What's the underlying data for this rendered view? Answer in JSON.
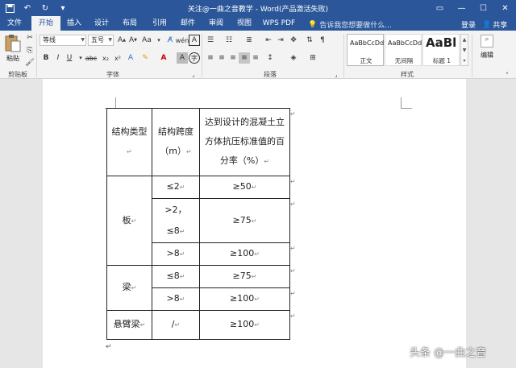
{
  "window": {
    "title": "关注@一曲之音教学 - Word(产品激活失败)",
    "qat_save_icon": "save-icon",
    "qat_undo_icon": "undo-icon",
    "qat_redo_icon": "redo-icon"
  },
  "tabs": [
    {
      "label": "文件"
    },
    {
      "label": "开始"
    },
    {
      "label": "插入"
    },
    {
      "label": "设计"
    },
    {
      "label": "布局"
    },
    {
      "label": "引用"
    },
    {
      "label": "邮件"
    },
    {
      "label": "审阅"
    },
    {
      "label": "视图"
    },
    {
      "label": "WPS PDF"
    }
  ],
  "tellme": "告诉我您想要做什么...",
  "account": {
    "login": "登录",
    "share": "共享"
  },
  "ribbon": {
    "clipboard": {
      "paste": "粘贴",
      "label": "剪贴板"
    },
    "font": {
      "name": "等线",
      "size": "五号",
      "label": "字体"
    },
    "paragraph": {
      "label": "段落"
    },
    "styles": {
      "label": "样式",
      "items": [
        {
          "sample": "AaBbCcDd",
          "name": "正文"
        },
        {
          "sample": "AaBbCcDd",
          "name": "无间隔"
        },
        {
          "sample": "AaBl",
          "name": "标题 1"
        }
      ]
    },
    "editing": {
      "label": "编辑"
    }
  },
  "table": {
    "header": {
      "c1": "结构类型",
      "c2": "结构跨度（m）",
      "c3": "达到设计的混凝土立方体抗压标准值的百分率（%）"
    },
    "rows": {
      "ban": "板",
      "ban_r1_span": "≤2",
      "ban_r1_val": "≥50",
      "ban_r2_span": ">2，≤8",
      "ban_r2_val": "≥75",
      "ban_r3_span": ">8",
      "ban_r3_val": "≥100",
      "liang": "梁",
      "liang_r1_span": "≤8",
      "liang_r1_val": "≥75",
      "liang_r2_span": ">8",
      "liang_r2_val": "≥100",
      "xuanbi": "悬臂梁",
      "xuanbi_span": "/",
      "xuanbi_val": "≥100"
    }
  },
  "watermark": "头条 @一曲之音"
}
